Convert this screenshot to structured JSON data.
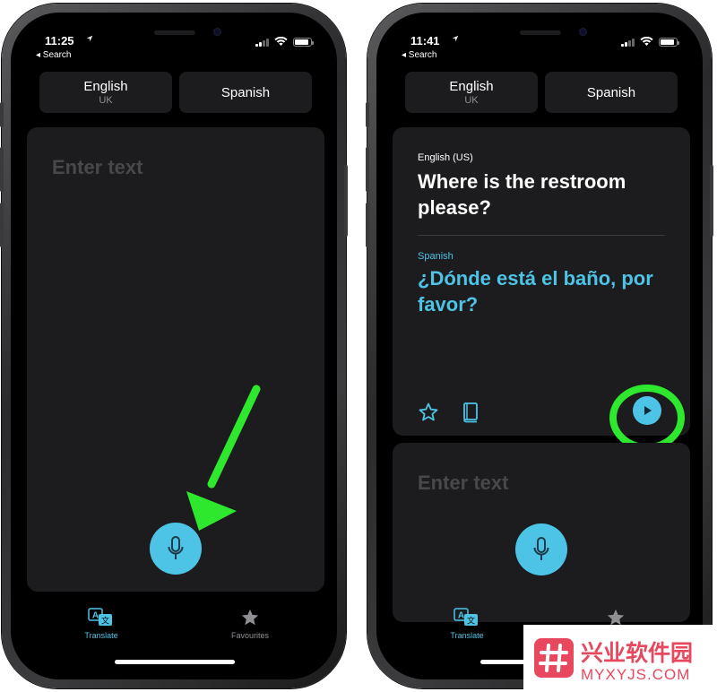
{
  "left_phone": {
    "status": {
      "time": "11:25",
      "back_label": "◂ Search"
    },
    "languages": [
      {
        "name": "English",
        "region": "UK"
      },
      {
        "name": "Spanish",
        "region": ""
      }
    ],
    "input": {
      "placeholder": "Enter text"
    },
    "tabs": [
      {
        "label": "Translate",
        "icon": "translate-icon",
        "active": true
      },
      {
        "label": "Favourites",
        "icon": "star-icon",
        "active": false
      }
    ]
  },
  "right_phone": {
    "status": {
      "time": "11:41",
      "back_label": "◂ Search"
    },
    "languages": [
      {
        "name": "English",
        "region": "UK"
      },
      {
        "name": "Spanish",
        "region": ""
      }
    ],
    "translation": {
      "source_language": "English (US)",
      "source_text": "Where is the restroom please?",
      "target_language": "Spanish",
      "target_text": "¿Dónde está el baño, por favor?"
    },
    "input": {
      "placeholder": "Enter text"
    },
    "tabs": [
      {
        "label": "Translate",
        "icon": "translate-icon",
        "active": true
      }
    ]
  },
  "annotations": {
    "arrow_color": "#2ee82e",
    "circle_color": "#2ee82e"
  },
  "colors": {
    "accent": "#4dc3e6",
    "card_bg": "#1c1c1e",
    "screen_bg": "#000000",
    "placeholder": "#48484a"
  },
  "watermark": {
    "title": "兴业软件园",
    "subtitle": "MYXYJS.COM"
  }
}
